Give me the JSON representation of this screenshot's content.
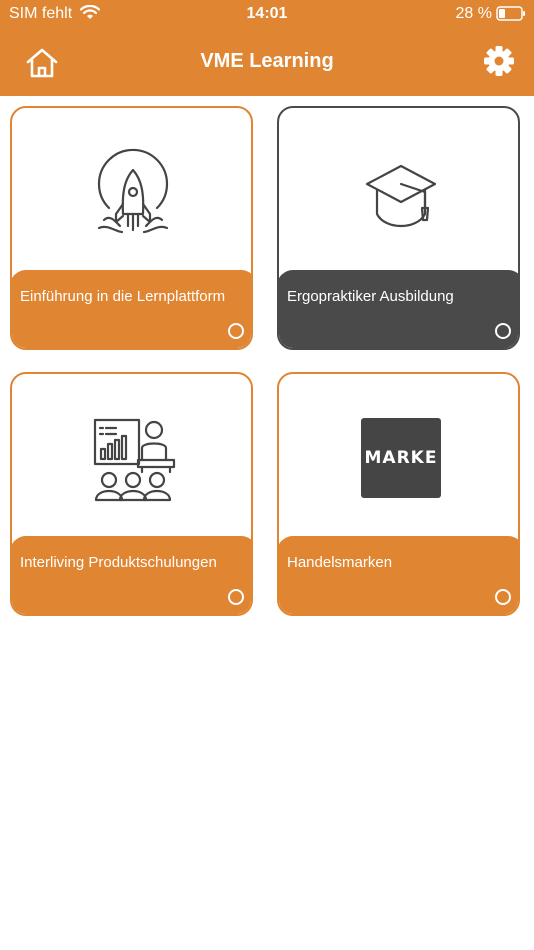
{
  "status_bar": {
    "carrier": "SIM fehlt",
    "time": "14:01",
    "battery_percent": "28 %"
  },
  "header": {
    "title": "VME Learning"
  },
  "cards": [
    {
      "label": "Einführung in die Lernplattform",
      "icon": "rocket-icon",
      "style": "orange"
    },
    {
      "label": "Ergopraktiker Ausbildung",
      "icon": "graduation-cap-icon",
      "style": "dark"
    },
    {
      "label": "Interliving Produktschulungen",
      "icon": "presentation-icon",
      "style": "orange"
    },
    {
      "label": "Handelsmarken",
      "icon": "marke-logo",
      "style": "orange",
      "logo_text": "MARKE"
    }
  ],
  "colors": {
    "accent": "#e08532",
    "dark": "#4a4a4a",
    "background": "#ffffff"
  }
}
